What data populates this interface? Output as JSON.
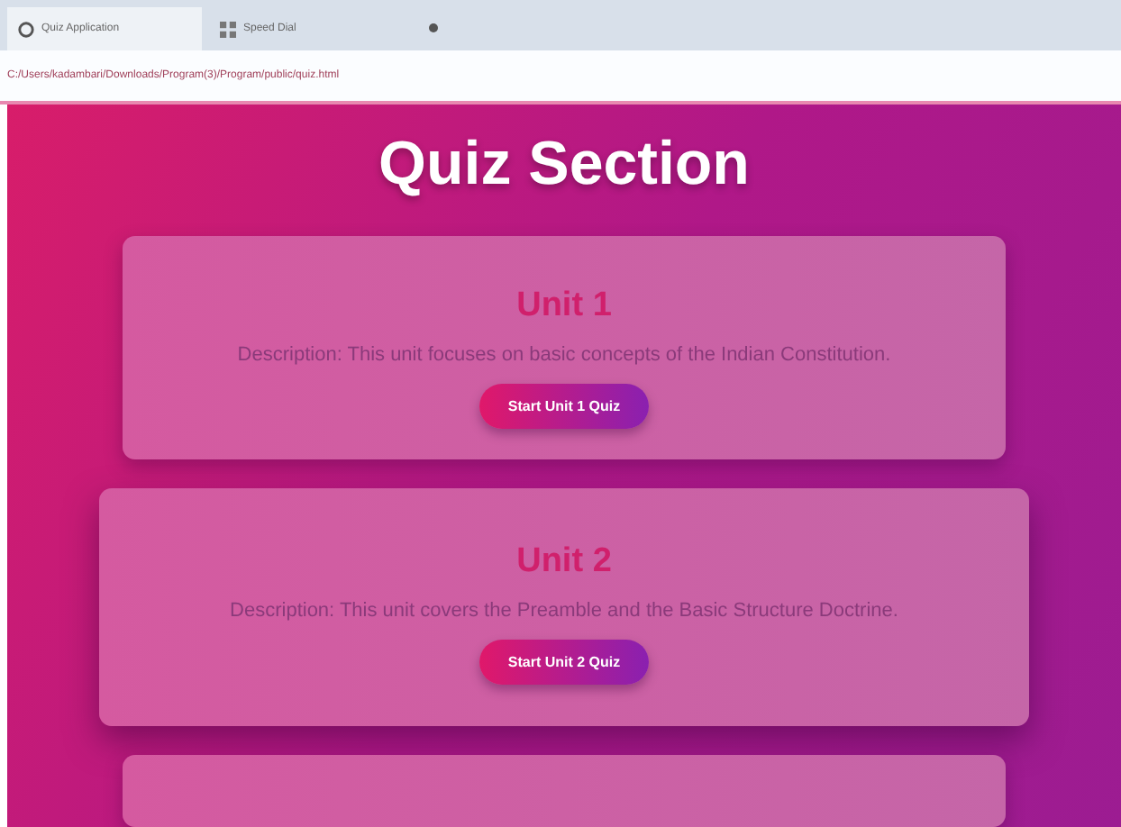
{
  "browser": {
    "tabs": [
      {
        "label": "Quiz Application",
        "kind": "page",
        "selected": true
      },
      {
        "label": "Speed Dial",
        "kind": "dial",
        "selected": false
      }
    ],
    "address": "C:/Users/kadambari/Downloads/Program(3)/Program/public/quiz.html"
  },
  "page": {
    "title": "Quiz Section",
    "cards": [
      {
        "title": "Unit 1",
        "description": "Description: This unit focuses on basic concepts of the Indian Constitution.",
        "button": "Start Unit 1 Quiz",
        "hovered": false
      },
      {
        "title": "Unit 2",
        "description": "Description: This unit covers the Preamble and the Basic Structure Doctrine.",
        "button": "Start Unit 2 Quiz",
        "hovered": true
      }
    ],
    "more_cards_below": true
  }
}
